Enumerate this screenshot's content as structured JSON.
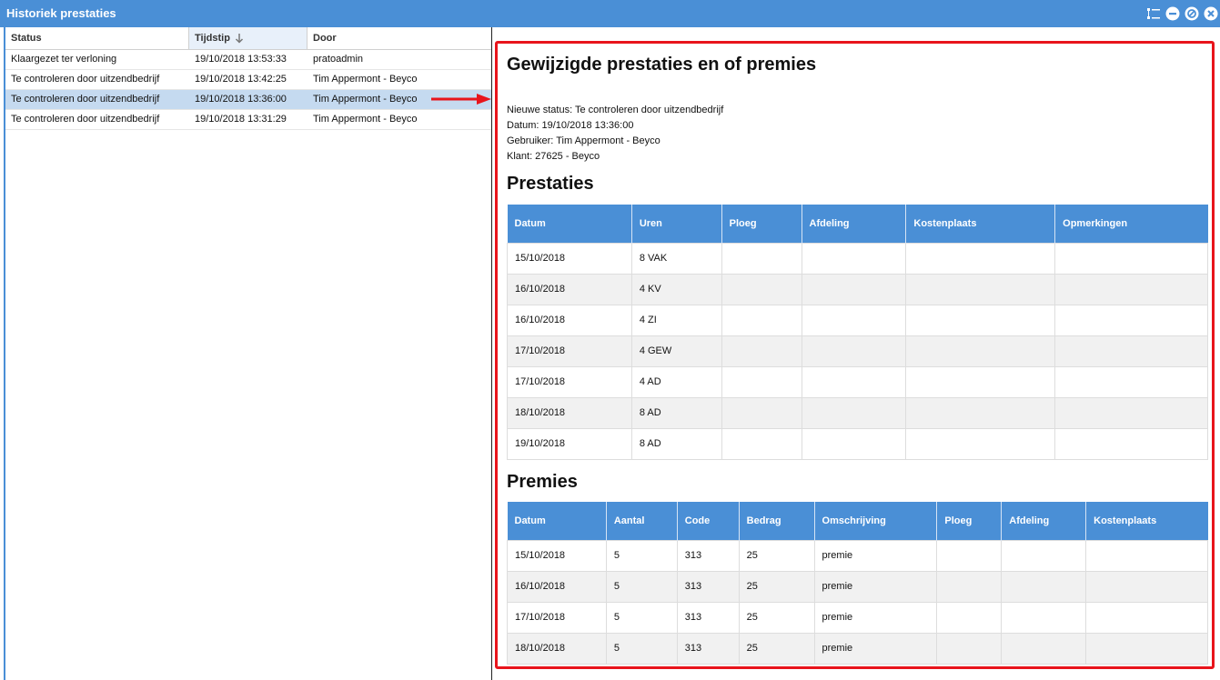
{
  "window": {
    "title": "Historiek prestaties"
  },
  "history": {
    "columns": [
      "Status",
      "Tijdstip",
      "Door"
    ],
    "rows": [
      {
        "status": "Klaargezet ter verloning",
        "tijdstip": "19/10/2018 13:53:33",
        "door": "pratoadmin"
      },
      {
        "status": "Te controleren door uitzendbedrijf",
        "tijdstip": "19/10/2018 13:42:25",
        "door": "Tim Appermont - Beyco"
      },
      {
        "status": "Te controleren door uitzendbedrijf",
        "tijdstip": "19/10/2018 13:36:00",
        "door": "Tim Appermont - Beyco"
      },
      {
        "status": "Te controleren door uitzendbedrijf",
        "tijdstip": "19/10/2018 13:31:29",
        "door": "Tim Appermont - Beyco"
      }
    ]
  },
  "detail": {
    "title": "Gewijzigde prestaties en of premies",
    "meta": {
      "status": "Nieuwe status: Te controleren door uitzendbedrijf",
      "datum": "Datum: 19/10/2018 13:36:00",
      "gebruiker": "Gebruiker: Tim Appermont - Beyco",
      "klant": "Klant: 27625 - Beyco"
    },
    "prestaties": {
      "heading": "Prestaties",
      "columns": [
        "Datum",
        "Uren",
        "Ploeg",
        "Afdeling",
        "Kostenplaats",
        "Opmerkingen"
      ],
      "rows": [
        [
          "15/10/2018",
          "8 VAK",
          "",
          "",
          "",
          ""
        ],
        [
          "16/10/2018",
          "4 KV",
          "",
          "",
          "",
          ""
        ],
        [
          "16/10/2018",
          "4 ZI",
          "",
          "",
          "",
          ""
        ],
        [
          "17/10/2018",
          "4 GEW",
          "",
          "",
          "",
          ""
        ],
        [
          "17/10/2018",
          "4 AD",
          "",
          "",
          "",
          ""
        ],
        [
          "18/10/2018",
          "8 AD",
          "",
          "",
          "",
          ""
        ],
        [
          "19/10/2018",
          "8 AD",
          "",
          "",
          "",
          ""
        ]
      ]
    },
    "premies": {
      "heading": "Premies",
      "columns": [
        "Datum",
        "Aantal",
        "Code",
        "Bedrag",
        "Omschrijving",
        "Ploeg",
        "Afdeling",
        "Kostenplaats"
      ],
      "rows": [
        [
          "15/10/2018",
          "5",
          "313",
          "25",
          "premie",
          "",
          "",
          ""
        ],
        [
          "16/10/2018",
          "5",
          "313",
          "25",
          "premie",
          "",
          "",
          ""
        ],
        [
          "17/10/2018",
          "5",
          "313",
          "25",
          "premie",
          "",
          "",
          ""
        ],
        [
          "18/10/2018",
          "5",
          "313",
          "25",
          "premie",
          "",
          "",
          ""
        ]
      ]
    }
  },
  "colors": {
    "accent": "#4a8fd6",
    "selected_row": "#c5daf0",
    "highlight_border": "#e8141b"
  },
  "icons": {
    "window_buttons": [
      "tree-view-icon",
      "minimize-icon",
      "restore-icon",
      "close-icon"
    ],
    "sort": "sort-descending-arrow-icon",
    "annotation": "red-arrow-icon"
  }
}
